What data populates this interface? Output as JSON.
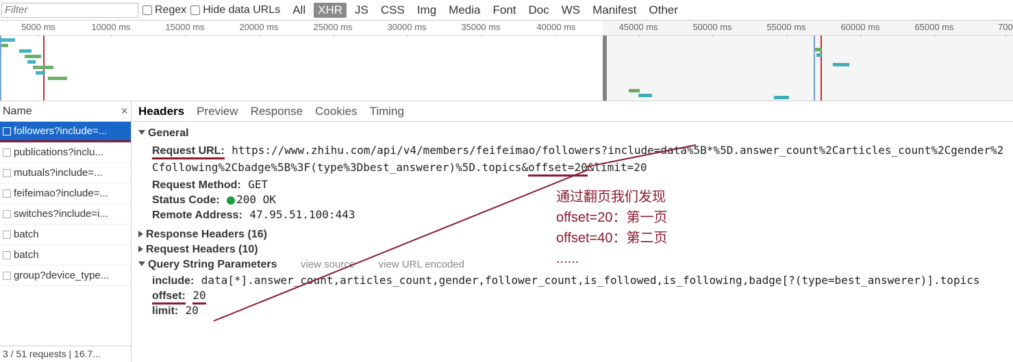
{
  "filter": {
    "placeholder": "Filter"
  },
  "options": {
    "regex": "Regex",
    "hide_data_urls": "Hide data URLs"
  },
  "types": [
    "All",
    "XHR",
    "JS",
    "CSS",
    "Img",
    "Media",
    "Font",
    "Doc",
    "WS",
    "Manifest",
    "Other"
  ],
  "types_active": "XHR",
  "timeline": {
    "ticks": [
      "5000 ms",
      "10000 ms",
      "15000 ms",
      "20000 ms",
      "25000 ms",
      "30000 ms",
      "35000 ms",
      "40000 ms",
      "45000 ms",
      "50000 ms",
      "55000 ms",
      "60000 ms",
      "65000 ms",
      "700"
    ]
  },
  "sidebar": {
    "header": "Name",
    "items": [
      "followers?include=...",
      "publications?inclu...",
      "mutuals?include=...",
      "feifeimao?include=...",
      "switches?include=i...",
      "batch",
      "batch",
      "group?device_type..."
    ],
    "selected_index": 0
  },
  "tabs": [
    "Headers",
    "Preview",
    "Response",
    "Cookies",
    "Timing"
  ],
  "tabs_active": "Headers",
  "general": {
    "title": "General",
    "request_url_label": "Request URL:",
    "request_url_value": "https://www.zhihu.com/api/v4/members/feifeimao/followers?include=data%5B*%5D.answer_count%2Carticles_count%2Cgender%2Cfollowing%2Cbadge%5B%3F(type%3Dbest_answerer)%5D.topics&offset=20&limit=20",
    "request_method_label": "Request Method:",
    "request_method_value": "GET",
    "status_code_label": "Status Code:",
    "status_code_value": "200 OK",
    "remote_address_label": "Remote Address:",
    "remote_address_value": "47.95.51.100:443"
  },
  "response_headers": {
    "title": "Response Headers (16)"
  },
  "request_headers": {
    "title": "Request Headers (10)"
  },
  "qsp": {
    "title": "Query String Parameters",
    "view_source": "view source",
    "view_url_encoded": "view URL encoded",
    "include_label": "include:",
    "include_value": "data[*].answer_count,articles_count,gender,follower_count,is_followed,is_following,badge[?(type=best_answerer)].topics",
    "offset_label": "offset:",
    "offset_value": "20",
    "limit_label": "limit:",
    "limit_value": "20"
  },
  "annotation": {
    "line1": "通过翻页我们发现",
    "line2": "offset=20：第一页",
    "line3": "offset=40：第二页",
    "line4": "......"
  },
  "status": "3 / 51 requests | 16.7..."
}
